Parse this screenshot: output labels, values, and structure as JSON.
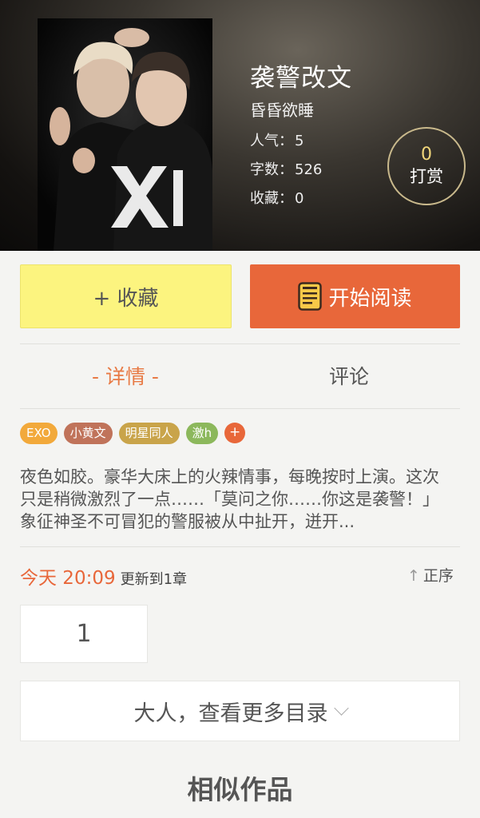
{
  "book": {
    "title": "袭警改文",
    "author": "昏昏欲睡",
    "stats": [
      {
        "label": "人气：",
        "value": "5"
      },
      {
        "label": "字数：",
        "value": "526"
      },
      {
        "label": "收藏：",
        "value": "0"
      }
    ],
    "reward": {
      "count": "0",
      "label": "打赏"
    }
  },
  "actions": {
    "collect_label": "+ 收藏",
    "read_label": "开始阅读"
  },
  "tabs": {
    "detail": "- 详情 -",
    "comment": "评论"
  },
  "tags": [
    {
      "label": "EXO",
      "color": "#f2a93b"
    },
    {
      "label": "小黄文",
      "color": "#c0735a"
    },
    {
      "label": "明星同人",
      "color": "#c9a44a"
    },
    {
      "label": "激h",
      "color": "#8cb85c"
    },
    {
      "label": "+",
      "color": "#e8673a"
    }
  ],
  "description": "夜色如胶。豪华大床上的火辣情事，每晚按时上演。这次只是稍微激烈了一点……「莫问之你……你这是袭警！」象征神圣不可冒犯的警服被从中扯开，迸开...",
  "update": {
    "time": "今天 20:09",
    "text": "更新到1章"
  },
  "order_label": "正序",
  "chapters": [
    "1"
  ],
  "more_catalog_label": "大人，查看更多目录",
  "similar_title": "相似作品",
  "colors": {
    "accent": "#e8673a",
    "collect_bg": "#fcf47f",
    "reward_num": "#f2d77a"
  }
}
